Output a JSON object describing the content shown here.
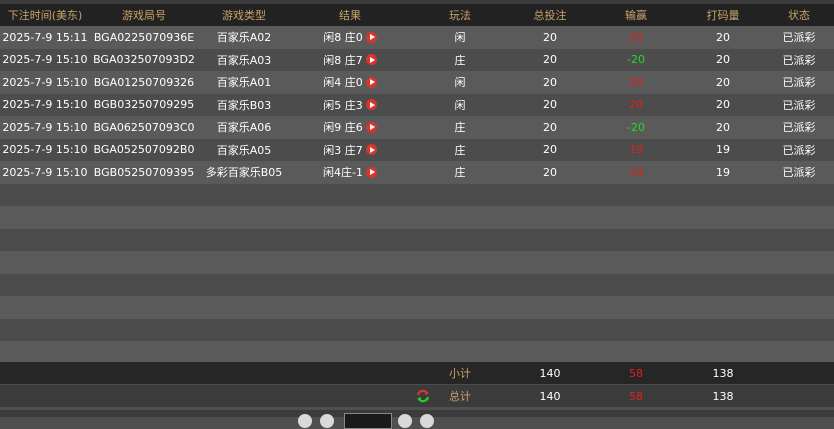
{
  "columns": [
    "下注时间(美东)",
    "游戏局号",
    "游戏类型",
    "结果",
    "玩法",
    "总投注",
    "输赢",
    "打码量",
    "状态"
  ],
  "rows": [
    {
      "time": "2025-7-9 15:11",
      "round": "BGA0225070936E",
      "type": "百家乐A02",
      "result": "闲8 庄0",
      "bet": "闲",
      "total": "20",
      "winloss": "20",
      "wl_color": "red",
      "code": "20",
      "status": "已派彩"
    },
    {
      "time": "2025-7-9 15:10",
      "round": "BGA032507093D2",
      "type": "百家乐A03",
      "result": "闲8 庄7",
      "bet": "庄",
      "total": "20",
      "winloss": "-20",
      "wl_color": "green",
      "code": "20",
      "status": "已派彩"
    },
    {
      "time": "2025-7-9 15:10",
      "round": "BGA01250709326",
      "type": "百家乐A01",
      "result": "闲4 庄0",
      "bet": "闲",
      "total": "20",
      "winloss": "20",
      "wl_color": "red",
      "code": "20",
      "status": "已派彩"
    },
    {
      "time": "2025-7-9 15:10",
      "round": "BGB03250709295",
      "type": "百家乐B03",
      "result": "闲5 庄3",
      "bet": "闲",
      "total": "20",
      "winloss": "20",
      "wl_color": "red",
      "code": "20",
      "status": "已派彩"
    },
    {
      "time": "2025-7-9 15:10",
      "round": "BGA062507093C0",
      "type": "百家乐A06",
      "result": "闲9 庄6",
      "bet": "庄",
      "total": "20",
      "winloss": "-20",
      "wl_color": "green",
      "code": "20",
      "status": "已派彩"
    },
    {
      "time": "2025-7-9 15:10",
      "round": "BGA052507092B0",
      "type": "百家乐A05",
      "result": "闲3 庄7",
      "bet": "庄",
      "total": "20",
      "winloss": "19",
      "wl_color": "red",
      "code": "19",
      "status": "已派彩"
    },
    {
      "time": "2025-7-9 15:10",
      "round": "BGB05250709395",
      "type": "多彩百家乐B05",
      "result": "闲4庄-1",
      "bet": "庄",
      "total": "20",
      "winloss": "19",
      "wl_color": "red",
      "code": "19",
      "status": "已派彩"
    }
  ],
  "empty_rows": 9,
  "subtotal": {
    "label": "小计",
    "total": "140",
    "winloss": "58",
    "code": "138"
  },
  "grand_total": {
    "label": "总计",
    "total": "140",
    "winloss": "58",
    "code": "138"
  },
  "icons": {
    "result": "play-icon",
    "refresh": "refresh-icon"
  },
  "colors": {
    "header_text": "#c9a36a",
    "loss": "#e0201e",
    "win": "#22dd22",
    "play": "#d8352f"
  }
}
